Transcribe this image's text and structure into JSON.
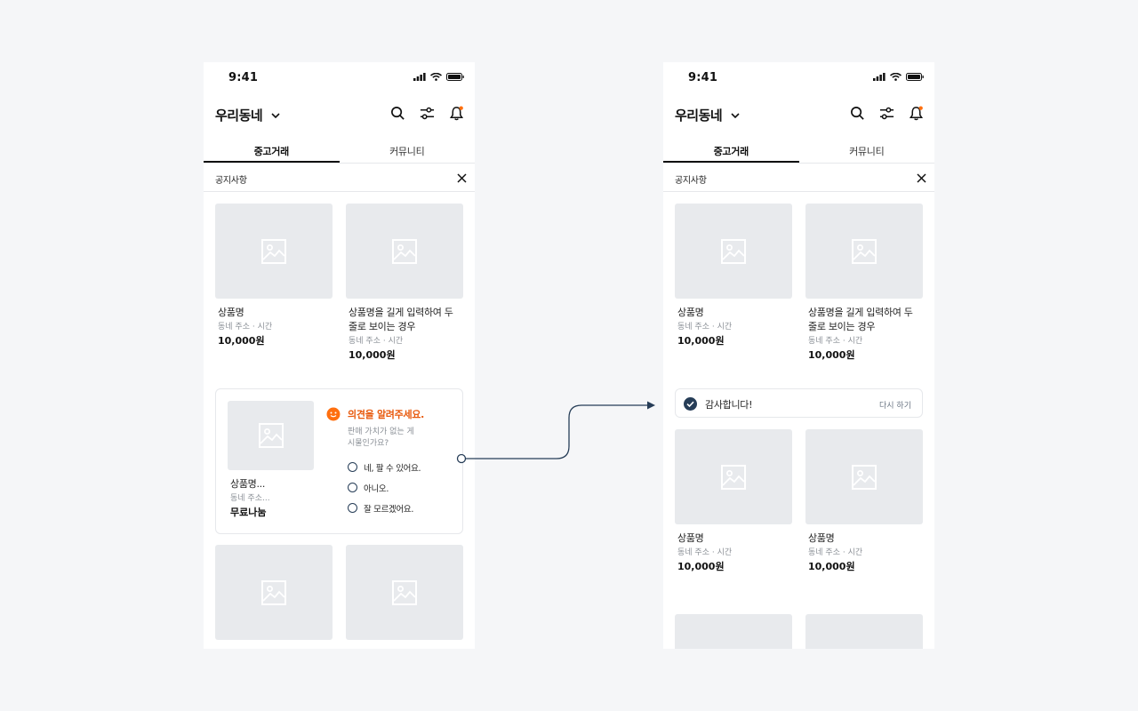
{
  "colors": {
    "background": "#f5f6f8",
    "placeholder": "#e8eaed",
    "accent_orange": "#e8590c",
    "navy": "#263d57",
    "notification_dot": "#ff6f0f"
  },
  "status_bar": {
    "time": "9:41"
  },
  "header": {
    "location": "우리동네"
  },
  "tabs": [
    "중고거래",
    "커뮤니티"
  ],
  "notice": {
    "label": "공지사항"
  },
  "products": [
    {
      "name": "상품명",
      "meta": "동네 주소 · 시간",
      "price": "10,000원"
    },
    {
      "name": "상품명을 길게 입력하여 두 줄로 보이는 경우",
      "meta": "동네 주소 · 시간",
      "price": "10,000원"
    }
  ],
  "survey": {
    "product": {
      "name": "상품명...",
      "meta": "동네 주소...",
      "price": "무료나눔"
    },
    "title": "의견을 알려주세요.",
    "description": "판매 가치가 없는 게시물인가요?",
    "options": [
      "네, 팔 수 있어요.",
      "아니오.",
      "잘 모르겠어요."
    ]
  },
  "thanks": {
    "message": "감사합니다!",
    "retry": "다시 하기"
  },
  "more_products": [
    {
      "name": "상품명",
      "meta": "동네 주소 · 시간",
      "price": "10,000원"
    },
    {
      "name": "상품명",
      "meta": "동네 주소 · 시간",
      "price": "10,000원"
    }
  ]
}
